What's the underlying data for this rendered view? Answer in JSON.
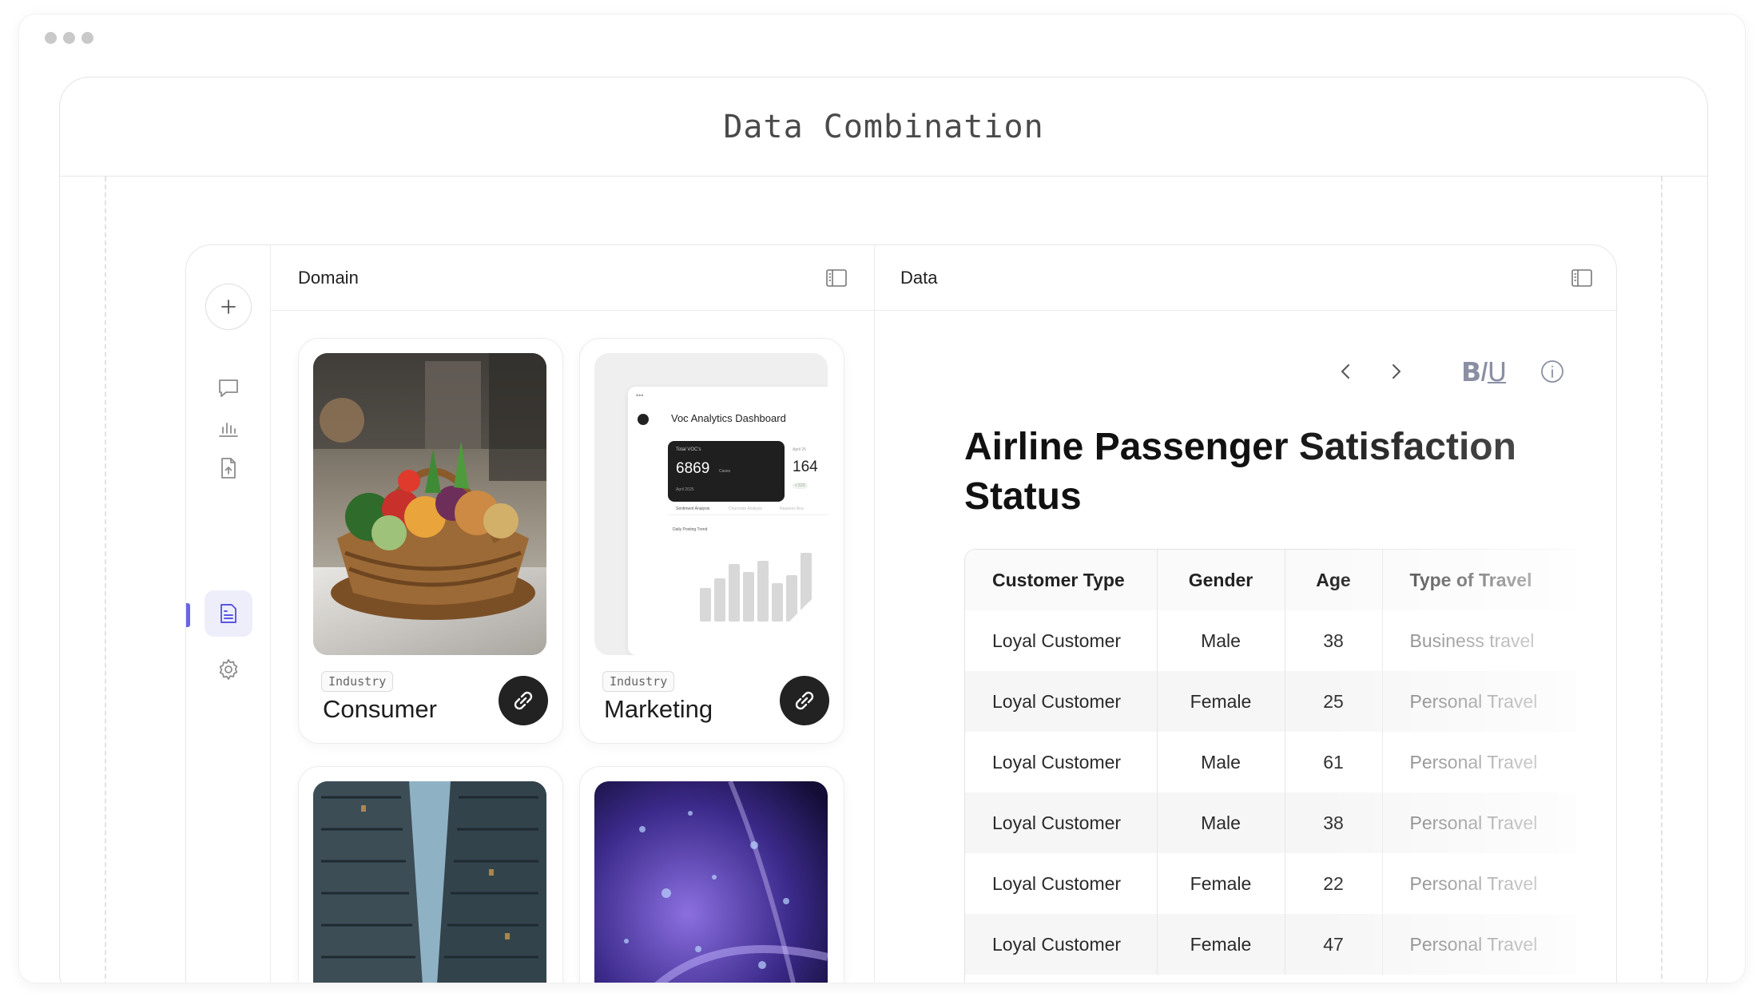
{
  "window": {
    "title": "Data Combination"
  },
  "rail": {
    "items": [
      "add-icon",
      "chat-icon",
      "bar-chart-icon",
      "file-upload-icon",
      "document-icon",
      "gear-icon"
    ],
    "active": "document-icon",
    "accent_color": "#6a64e8"
  },
  "domain_panel": {
    "title": "Domain",
    "cards": [
      {
        "tag": "Industry",
        "name": "Consumer",
        "image": "vegetable-basket"
      },
      {
        "tag": "Industry",
        "name": "Marketing",
        "image": "analytics-dashboard-preview"
      },
      {
        "image": "city-skyscrapers"
      },
      {
        "image": "purple-bubbles"
      }
    ],
    "dashboard_preview": {
      "title": "Voc Analytics Dashboard",
      "metric_label": "Total VOC's",
      "metric_value": "6869",
      "metric_unit": "Cases",
      "metric_date": "April 2025",
      "metric2_date": "April 25",
      "metric2_value": "164",
      "metric2_delta": "+ 523",
      "tabs": [
        "Sentiment Analysis",
        "Churnrate Analysis",
        "Reasons Ana"
      ],
      "chart_title": "Daily Posting Trend"
    }
  },
  "data_panel": {
    "title": "Data",
    "toolbar": {
      "format_label_b": "B",
      "format_label_i": "I",
      "format_label_u": "U"
    },
    "document_title": "Airline Passenger Satisfaction Status",
    "table": {
      "columns": [
        "Customer Type",
        "Gender",
        "Age",
        "Type of Travel"
      ],
      "rows": [
        [
          "Loyal Customer",
          "Male",
          "38",
          "Business travel"
        ],
        [
          "Loyal Customer",
          "Female",
          "25",
          "Personal Travel"
        ],
        [
          "Loyal Customer",
          "Male",
          "61",
          "Personal Travel"
        ],
        [
          "Loyal Customer",
          "Male",
          "38",
          "Personal Travel"
        ],
        [
          "Loyal Customer",
          "Female",
          "22",
          "Personal Travel"
        ],
        [
          "Loyal Customer",
          "Female",
          "47",
          "Personal Travel"
        ]
      ]
    }
  }
}
